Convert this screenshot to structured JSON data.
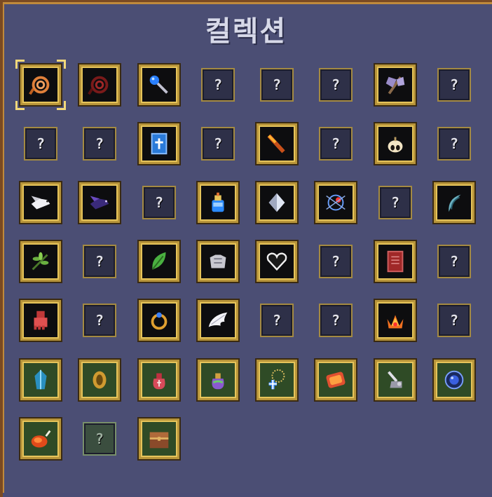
{
  "title": "컬렉션",
  "grid": [
    {
      "kind": "item",
      "icon": "whip-icon",
      "ground": "dark",
      "selected": true
    },
    {
      "kind": "item",
      "icon": "bloody-whip-icon",
      "ground": "dark"
    },
    {
      "kind": "item",
      "icon": "magic-wand-icon",
      "ground": "dark"
    },
    {
      "kind": "locked",
      "label": "?"
    },
    {
      "kind": "locked",
      "label": "?"
    },
    {
      "kind": "locked",
      "label": "?"
    },
    {
      "kind": "item",
      "icon": "axe-icon",
      "ground": "dark"
    },
    {
      "kind": "locked",
      "label": "?"
    },
    {
      "kind": "locked",
      "label": "?"
    },
    {
      "kind": "locked",
      "label": "?"
    },
    {
      "kind": "item",
      "icon": "bible-icon",
      "ground": "dark"
    },
    {
      "kind": "locked",
      "label": "?"
    },
    {
      "kind": "item",
      "icon": "fire-wand-icon",
      "ground": "dark"
    },
    {
      "kind": "locked",
      "label": "?"
    },
    {
      "kind": "item",
      "icon": "garlic-icon",
      "ground": "dark"
    },
    {
      "kind": "locked",
      "label": "?"
    },
    {
      "kind": "item",
      "icon": "white-dove-icon",
      "ground": "dark"
    },
    {
      "kind": "item",
      "icon": "black-bird-icon",
      "ground": "dark"
    },
    {
      "kind": "locked",
      "label": "?"
    },
    {
      "kind": "item",
      "icon": "holy-water-icon",
      "ground": "dark"
    },
    {
      "kind": "item",
      "icon": "diamond-icon",
      "ground": "dark"
    },
    {
      "kind": "item",
      "icon": "clock-lancet-icon",
      "ground": "dark"
    },
    {
      "kind": "locked",
      "label": "?"
    },
    {
      "kind": "item",
      "icon": "crescent-icon",
      "ground": "dark"
    },
    {
      "kind": "item",
      "icon": "clover-leaf-icon",
      "ground": "dark"
    },
    {
      "kind": "locked",
      "label": "?"
    },
    {
      "kind": "item",
      "icon": "green-leaf-icon",
      "ground": "dark"
    },
    {
      "kind": "item",
      "icon": "armor-icon",
      "ground": "dark"
    },
    {
      "kind": "item",
      "icon": "heart-icon",
      "ground": "dark"
    },
    {
      "kind": "locked",
      "label": "?"
    },
    {
      "kind": "item",
      "icon": "red-book-icon",
      "ground": "dark"
    },
    {
      "kind": "locked",
      "label": "?"
    },
    {
      "kind": "item",
      "icon": "gauntlet-icon",
      "ground": "dark"
    },
    {
      "kind": "locked",
      "label": "?"
    },
    {
      "kind": "item",
      "icon": "ring-icon",
      "ground": "dark"
    },
    {
      "kind": "item",
      "icon": "wings-icon",
      "ground": "dark"
    },
    {
      "kind": "locked",
      "label": "?"
    },
    {
      "kind": "locked",
      "label": "?"
    },
    {
      "kind": "item",
      "icon": "crown-icon",
      "ground": "dark"
    },
    {
      "kind": "locked",
      "label": "?"
    },
    {
      "kind": "item",
      "icon": "blue-gem-icon",
      "ground": "green"
    },
    {
      "kind": "item",
      "icon": "gold-coin-icon",
      "ground": "green"
    },
    {
      "kind": "item",
      "icon": "red-money-bag-icon",
      "ground": "green"
    },
    {
      "kind": "item",
      "icon": "rainbow-money-bag-icon",
      "ground": "green"
    },
    {
      "kind": "item",
      "icon": "rosary-icon",
      "ground": "green"
    },
    {
      "kind": "item",
      "icon": "orologion-icon",
      "ground": "green"
    },
    {
      "kind": "item",
      "icon": "vacuum-icon",
      "ground": "green"
    },
    {
      "kind": "item",
      "icon": "blue-orb-icon",
      "ground": "green"
    },
    {
      "kind": "item",
      "icon": "roast-chicken-icon",
      "ground": "green"
    },
    {
      "kind": "locked",
      "label": "?",
      "ground": "green"
    },
    {
      "kind": "item",
      "icon": "treasure-chest-icon",
      "ground": "green"
    }
  ]
}
